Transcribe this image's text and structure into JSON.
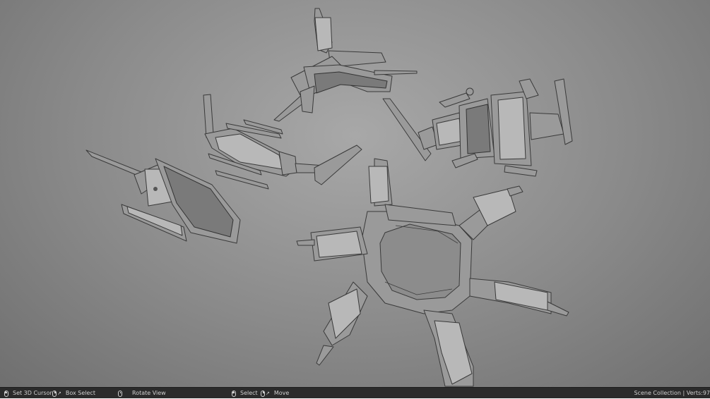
{
  "statusbar": {
    "set_cursor": "Set 3D Cursor",
    "box_select": "Box Select",
    "rotate_view": "Rotate View",
    "select": "Select",
    "move": "Move",
    "stats": "Scene Collection | Verts:97"
  },
  "icons": {
    "mouse_left": "mouse-left-icon",
    "mouse_right": "mouse-right-icon",
    "mouse_middle": "mouse-middle-icon"
  }
}
